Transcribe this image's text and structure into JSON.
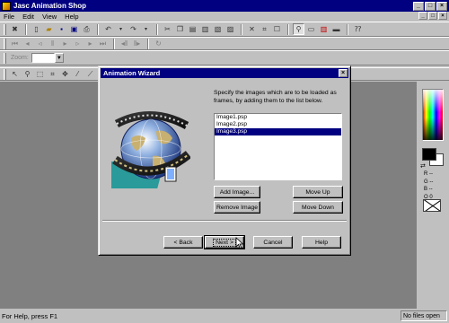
{
  "app": {
    "title": "Jasc Animation Shop",
    "window_buttons": [
      "_",
      "□",
      "×"
    ]
  },
  "menu": {
    "items": [
      "File",
      "Edit",
      "View",
      "Help"
    ],
    "mdi_buttons": [
      "_",
      "□",
      "×"
    ]
  },
  "toolbar": {
    "zoom_label": "Zoom:",
    "zoom_value": ""
  },
  "right_panel": {
    "rgb_labels": [
      "R --",
      "G --",
      "B --",
      "O 0"
    ]
  },
  "status": {
    "left": "For Help, press F1",
    "right": "No files open"
  },
  "dialog": {
    "title": "Animation Wizard",
    "close": "×",
    "instructions": "Specify the images which are to be loaded as frames, by adding them to the list below.",
    "frames": [
      {
        "name": "Image1.psp",
        "selected": false
      },
      {
        "name": "Image2.psp",
        "selected": false
      },
      {
        "name": "Image3.psp",
        "selected": true
      }
    ],
    "buttons": {
      "add": "Add Image...",
      "remove": "Remove Image",
      "move_up": "Move Up",
      "move_down": "Move Down",
      "back": "< Back",
      "next": "Next >",
      "cancel": "Cancel",
      "help": "Help"
    }
  },
  "colors": {
    "titlebar": "#000080",
    "face": "#c0c0c0",
    "workspace": "#808080",
    "selection": "#000080"
  },
  "icons": {
    "toolbar1": [
      "pointer-icon",
      "sep",
      "new-icon",
      "open-icon",
      "save-icon",
      "save-as-icon",
      "print-icon",
      "sep",
      "undo-icon",
      "undo-drop-icon",
      "redo-icon",
      "redo-drop-icon",
      "sep",
      "cut-icon",
      "copy-icon",
      "paste-icon",
      "paste-new-icon",
      "paste-before-icon",
      "paste-after-icon",
      "sep",
      "delete-icon",
      "crop-icon",
      "frame-props-icon",
      "sep",
      "zoom-icon",
      "view-frames-icon",
      "color-bars-icon",
      "screen-icon",
      "sep",
      "help-pointer-icon"
    ],
    "toolbar2": [
      "first-frame-icon",
      "prev-frame-icon",
      "rewind-icon",
      "pause-icon",
      "play-icon",
      "forward-icon",
      "next-frame-icon",
      "last-frame-icon",
      "sep",
      "loop-icon",
      "stop-icon",
      "sep",
      "refresh-icon"
    ],
    "toolbar4": [
      "arrow-tool-icon",
      "zoom-tool-icon",
      "select-tool-icon",
      "crop-tool-icon",
      "move-tool-icon",
      "eyedropper-icon",
      "paintbrush-icon"
    ]
  }
}
